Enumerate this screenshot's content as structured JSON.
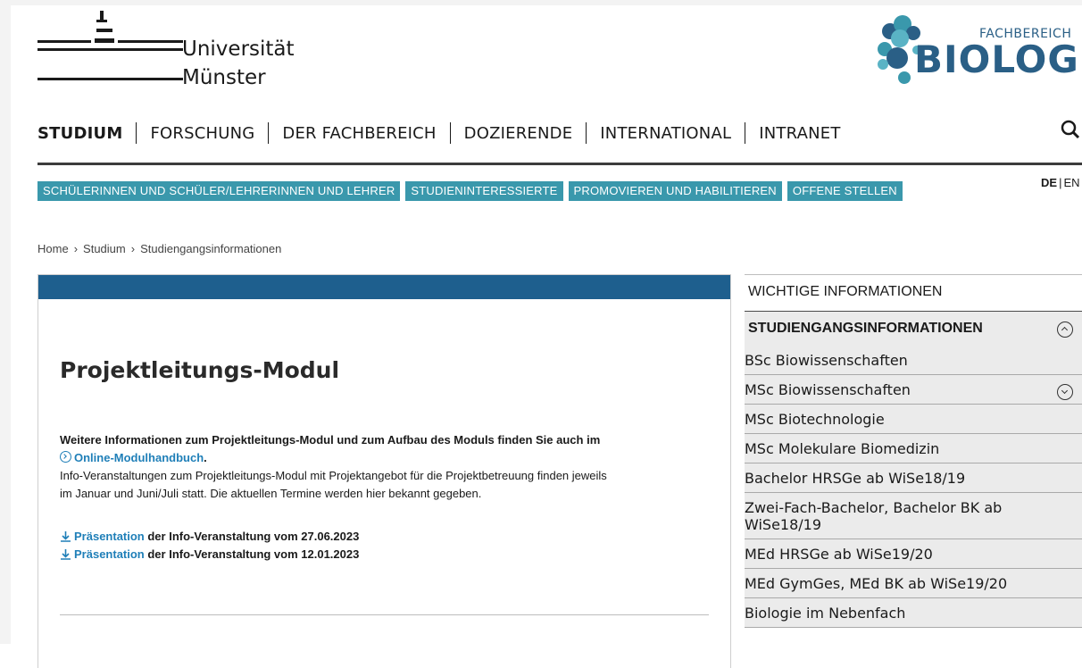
{
  "logo": {
    "line1": "Universität",
    "line2": "Münster"
  },
  "faculty_logo": {
    "small": "FACHBEREICH",
    "big": "BIOLOGIE"
  },
  "main_nav": [
    "STUDIUM",
    "FORSCHUNG",
    "DER FACHBEREICH",
    "DOZIERENDE",
    "INTERNATIONAL",
    "INTRANET"
  ],
  "sub_nav": [
    "SCHÜLERINNEN UND SCHÜLER/LEHRERINNEN UND LEHRER",
    "STUDIENINTERESSIERTE",
    "PROMOVIEREN UND HABILITIEREN",
    "OFFENE STELLEN"
  ],
  "lang": {
    "de": "DE",
    "en": "EN"
  },
  "breadcrumb": [
    "Home",
    "Studium",
    "Studiengangsinformationen"
  ],
  "breadcrumb_sep": "›",
  "content": {
    "title": "Projektleitungs-Modul",
    "para1_bold": "Weitere Informationen zum Projektleitungs-Modul und zum Aufbau des Moduls finden Sie auch im",
    "modulhandbuch_link": "Online-Modulhandbuch",
    "para1_end": ".",
    "para2_line1": "Info-Veranstaltungen zum Projektleitungs-Modul mit Projektangebot für die Projektbetreuung finden jeweils",
    "para2_line2": "im Januar und Juni/Juli statt. Die aktuellen Termine werden hier bekannt gegeben.",
    "downloads": [
      {
        "link": "Präsentation",
        "text": " der Info-Veranstaltung vom 27.06.2023"
      },
      {
        "link": "Präsentation",
        "text": " der Info-Veranstaltung vom 12.01.2023"
      }
    ]
  },
  "sidebar": {
    "header": "WICHTIGE INFORMATIONEN",
    "section_title": "STUDIENGANGSINFORMATIONEN",
    "items": [
      "BSc Biowissenschaften",
      "MSc Biowissenschaften",
      "MSc Biotechnologie",
      "MSc Molekulare Biomedizin",
      "Bachelor HRSGe ab WiSe18/19",
      "Zwei-Fach-Bachelor, Bachelor BK ab WiSe18/19",
      "MEd HRSGe ab WiSe19/20",
      "MEd GymGes, MEd BK ab WiSe19/20",
      "Biologie im Nebenfach"
    ]
  },
  "colors": {
    "chip": "#3a98ac",
    "content_topbar": "#1e5f8e",
    "link": "#1f7fb8",
    "brand": "#2a5f86",
    "sidebar_bg": "#ebebeb"
  },
  "icons": [
    "search-icon",
    "chevron-circle-right-icon",
    "download-icon",
    "collapse-circle-icon",
    "expand-circle-icon"
  ]
}
